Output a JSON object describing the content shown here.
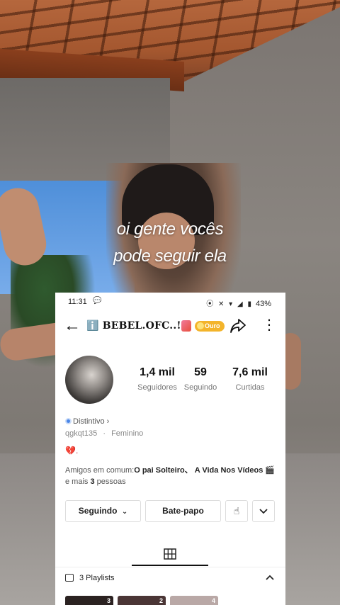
{
  "overlay": {
    "caption_line1": "oi gente vocês",
    "caption_line2": "pode seguir ela"
  },
  "status_bar": {
    "time": "11:31",
    "notification_icon": "chat-bubble-icon",
    "battery": "43%"
  },
  "header": {
    "back_icon": "arrow-left-icon",
    "username": "ℹ️ BEBEL.OFC..!",
    "badge_label": "Ouro",
    "share_icon": "share-icon",
    "more_icon": "more-vertical-icon"
  },
  "profile": {
    "stats": [
      {
        "value": "1,4 mil",
        "label": "Seguidores"
      },
      {
        "value": "59",
        "label": "Seguindo"
      },
      {
        "value": "7,6 mil",
        "label": "Curtidas"
      }
    ],
    "distintivo": "Distintivo ›",
    "handle": "qgkqt135",
    "separator": "·",
    "gender": "Feminino",
    "bio": "💔.",
    "friends_prefix": "Amigos em comum:",
    "friends_names": "O pai Solteiro、 A Vida Nos Vídeos 🎬",
    "friends_suffix_pre": " e mais ",
    "friends_count": "3",
    "friends_suffix_post": " pessoas"
  },
  "actions": {
    "following_label": "Seguindo",
    "following_chevron": "⌄",
    "chat_label": "Bate-papo",
    "wave_icon": "wave-hand-icon",
    "dropdown_icon": "chevron-down-icon"
  },
  "tabs": {
    "videos_icon": "grid-icon"
  },
  "playlists": {
    "label": "3 Playlists",
    "collapse_icon": "chevron-up-icon",
    "items": [
      {
        "count": "3"
      },
      {
        "count": "2"
      },
      {
        "count": "4"
      }
    ]
  },
  "colors": {
    "badge": "#f3b42b",
    "bio_heart": "#c2273a",
    "distintivo_icon": "#4a86e8"
  }
}
